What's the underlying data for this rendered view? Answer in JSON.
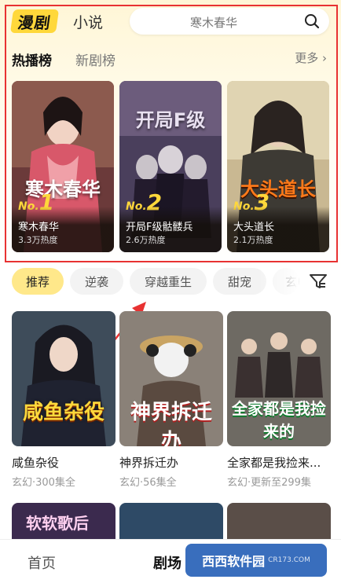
{
  "header": {
    "logo_text": "漫剧",
    "novel_tab": "小说",
    "search_placeholder": "寒木春华"
  },
  "ranking": {
    "tab_hot": "热播榜",
    "tab_new": "新剧榜",
    "more": "更多 ›",
    "items": [
      {
        "rank_prefix": "No.",
        "rank": "1",
        "title": "寒木春华",
        "heat": "3.3万热度",
        "art": "寒木春华"
      },
      {
        "rank_prefix": "No.",
        "rank": "2",
        "title": "开局F级骷髅兵",
        "heat": "2.6万热度",
        "art": "开局F级"
      },
      {
        "rank_prefix": "No.",
        "rank": "3",
        "title": "大头道长",
        "heat": "2.1万热度",
        "art": "大头道长"
      }
    ]
  },
  "filters": [
    "推荐",
    "逆袭",
    "穿越重生",
    "甜宠",
    "玄"
  ],
  "grid": [
    {
      "title": "咸鱼杂役",
      "meta": "玄幻·300集全",
      "art": "咸鱼杂役"
    },
    {
      "title": "神界拆迁办",
      "meta": "玄幻·56集全",
      "art": "神界拆迁办"
    },
    {
      "title": "全家都是我捡来...",
      "meta": "玄幻·更新至299集",
      "art": "全家都是我捡来的"
    }
  ],
  "partial_art": "软软歌后",
  "bottom_nav": {
    "home": "首页",
    "theater": "剧场"
  },
  "watermark": {
    "brand": "西西软件园",
    "url": "CR173.COM"
  },
  "colors": {
    "accent_yellow": "#ffd83b",
    "highlight_red": "#e83232"
  }
}
